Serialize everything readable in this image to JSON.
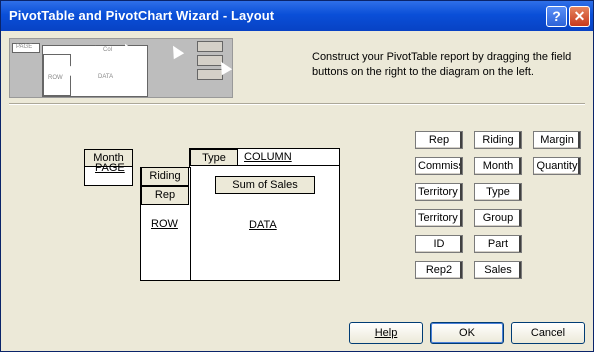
{
  "window": {
    "title": "PivotTable and PivotChart Wizard - Layout",
    "help_glyph": "?",
    "close_glyph": "✕"
  },
  "preview": {
    "labels": {
      "page": "PAGE",
      "row": "ROW",
      "data": "DATA",
      "col": "Col"
    }
  },
  "instructions": "Construct your PivotTable report by dragging the field buttons on the right to the diagram on the left.",
  "layout": {
    "page_field": "Month",
    "page_area_label": "PAGE",
    "column_field_type": "Type",
    "column_area_label": "COLUMN",
    "row_fields": [
      "Riding",
      "Rep"
    ],
    "row_area_label": "ROW",
    "data_field": "Sum of Sales",
    "data_area_label": "DATA"
  },
  "field_buttons": [
    "Rep",
    "Riding",
    "Margin",
    "Commissio",
    "Month",
    "Quantity",
    "Territory I",
    "Type",
    "Territory I",
    "Group",
    "ID",
    "Part",
    "Rep2",
    "Sales"
  ],
  "buttons": {
    "help": "Help",
    "ok": "OK",
    "cancel": "Cancel"
  }
}
